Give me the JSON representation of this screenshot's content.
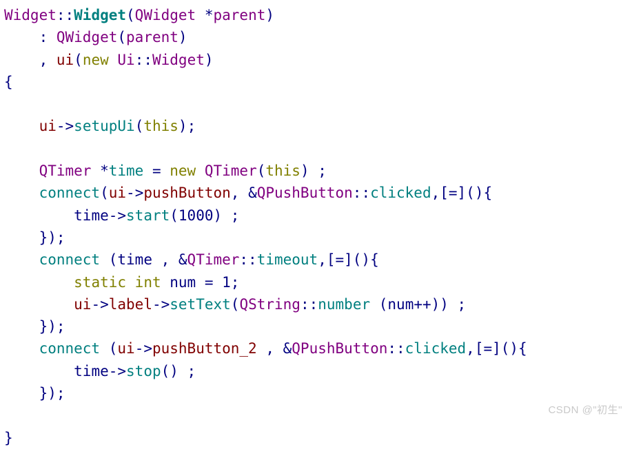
{
  "editor": {
    "background": "#ffffff",
    "language": "cpp",
    "palette": {
      "plain": "#000080",
      "type": "#800080",
      "function": "#007f7f",
      "keyword": "#808000",
      "member": "#800000",
      "number": "#000080",
      "punctuation": "#000080",
      "watermark": "#c9c9c9"
    },
    "lines": [
      {
        "index": 0,
        "text": "Widget::Widget(QWidget *parent)",
        "tokens": [
          {
            "t": "Widget",
            "c": "#800080"
          },
          {
            "t": "::",
            "c": "#000080"
          },
          {
            "t": "Widget",
            "c": "#007f7f",
            "b": true
          },
          {
            "t": "(",
            "c": "#000080"
          },
          {
            "t": "QWidget",
            "c": "#800080"
          },
          {
            "t": " ",
            "c": "#000080"
          },
          {
            "t": "*",
            "c": "#000080"
          },
          {
            "t": "parent",
            "c": "#800080"
          },
          {
            "t": ")",
            "c": "#000080"
          }
        ]
      },
      {
        "index": 1,
        "text": "    : QWidget(parent)",
        "tokens": [
          {
            "t": "    : ",
            "c": "#000080"
          },
          {
            "t": "QWidget",
            "c": "#800080"
          },
          {
            "t": "(",
            "c": "#000080"
          },
          {
            "t": "parent",
            "c": "#800080"
          },
          {
            "t": ")",
            "c": "#000080"
          }
        ]
      },
      {
        "index": 2,
        "text": "    , ui(new Ui::Widget)",
        "tokens": [
          {
            "t": "    , ",
            "c": "#000080"
          },
          {
            "t": "ui",
            "c": "#800000"
          },
          {
            "t": "(",
            "c": "#000080"
          },
          {
            "t": "new",
            "c": "#808000"
          },
          {
            "t": " ",
            "c": "#000080"
          },
          {
            "t": "Ui",
            "c": "#800080"
          },
          {
            "t": "::",
            "c": "#000080"
          },
          {
            "t": "Widget",
            "c": "#800080"
          },
          {
            "t": ")",
            "c": "#000080"
          }
        ]
      },
      {
        "index": 3,
        "text": "{",
        "tokens": [
          {
            "t": "{",
            "c": "#000080"
          }
        ]
      },
      {
        "index": 4,
        "text": "",
        "tokens": []
      },
      {
        "index": 5,
        "text": "    ui->setupUi(this);",
        "tokens": [
          {
            "t": "    ",
            "c": "#000080"
          },
          {
            "t": "ui",
            "c": "#800000"
          },
          {
            "t": "->",
            "c": "#000080"
          },
          {
            "t": "setupUi",
            "c": "#007f7f"
          },
          {
            "t": "(",
            "c": "#000080"
          },
          {
            "t": "this",
            "c": "#808000"
          },
          {
            "t": ");",
            "c": "#000080"
          }
        ]
      },
      {
        "index": 6,
        "text": "",
        "tokens": []
      },
      {
        "index": 7,
        "text": "    QTimer *time = new QTimer(this) ;",
        "tokens": [
          {
            "t": "    ",
            "c": "#000080"
          },
          {
            "t": "QTimer",
            "c": "#800080"
          },
          {
            "t": " ",
            "c": "#000080"
          },
          {
            "t": "*",
            "c": "#000080"
          },
          {
            "t": "time",
            "c": "#007f7f"
          },
          {
            "t": " = ",
            "c": "#000080"
          },
          {
            "t": "new",
            "c": "#808000"
          },
          {
            "t": " ",
            "c": "#000080"
          },
          {
            "t": "QTimer",
            "c": "#800080"
          },
          {
            "t": "(",
            "c": "#000080"
          },
          {
            "t": "this",
            "c": "#808000"
          },
          {
            "t": ") ;",
            "c": "#000080"
          }
        ]
      },
      {
        "index": 8,
        "text": "    connect(ui->pushButton, &QPushButton::clicked,[=](){",
        "tokens": [
          {
            "t": "    ",
            "c": "#000080"
          },
          {
            "t": "connect",
            "c": "#007f7f"
          },
          {
            "t": "(",
            "c": "#000080"
          },
          {
            "t": "ui",
            "c": "#800000"
          },
          {
            "t": "->",
            "c": "#000080"
          },
          {
            "t": "pushButton",
            "c": "#800000"
          },
          {
            "t": ", &",
            "c": "#000080"
          },
          {
            "t": "QPushButton",
            "c": "#800080"
          },
          {
            "t": "::",
            "c": "#000080"
          },
          {
            "t": "clicked",
            "c": "#007f7f"
          },
          {
            "t": ",[=](){",
            "c": "#000080"
          }
        ]
      },
      {
        "index": 9,
        "text": "        time->start(1000) ;",
        "tokens": [
          {
            "t": "        ",
            "c": "#000080"
          },
          {
            "t": "time",
            "c": "#000080"
          },
          {
            "t": "->",
            "c": "#000080"
          },
          {
            "t": "start",
            "c": "#007f7f"
          },
          {
            "t": "(",
            "c": "#000080"
          },
          {
            "t": "1000",
            "c": "#000080"
          },
          {
            "t": ") ;",
            "c": "#000080"
          }
        ]
      },
      {
        "index": 10,
        "text": "    });",
        "tokens": [
          {
            "t": "    });",
            "c": "#000080"
          }
        ]
      },
      {
        "index": 11,
        "text": "    connect (time , &QTimer::timeout,[=](){",
        "tokens": [
          {
            "t": "    ",
            "c": "#000080"
          },
          {
            "t": "connect",
            "c": "#007f7f"
          },
          {
            "t": " (",
            "c": "#000080"
          },
          {
            "t": "time",
            "c": "#000080"
          },
          {
            "t": " , &",
            "c": "#000080"
          },
          {
            "t": "QTimer",
            "c": "#800080"
          },
          {
            "t": "::",
            "c": "#000080"
          },
          {
            "t": "timeout",
            "c": "#007f7f"
          },
          {
            "t": ",[=](){",
            "c": "#000080"
          }
        ]
      },
      {
        "index": 12,
        "text": "        static int num = 1;",
        "tokens": [
          {
            "t": "        ",
            "c": "#000080"
          },
          {
            "t": "static",
            "c": "#808000"
          },
          {
            "t": " ",
            "c": "#000080"
          },
          {
            "t": "int",
            "c": "#808000"
          },
          {
            "t": " ",
            "c": "#000080"
          },
          {
            "t": "num",
            "c": "#000080"
          },
          {
            "t": " = ",
            "c": "#000080"
          },
          {
            "t": "1",
            "c": "#000080"
          },
          {
            "t": ";",
            "c": "#000080"
          }
        ]
      },
      {
        "index": 13,
        "text": "        ui->label->setText(QString::number (num++)) ;",
        "tokens": [
          {
            "t": "        ",
            "c": "#000080"
          },
          {
            "t": "ui",
            "c": "#800000"
          },
          {
            "t": "->",
            "c": "#000080"
          },
          {
            "t": "label",
            "c": "#800000"
          },
          {
            "t": "->",
            "c": "#000080"
          },
          {
            "t": "setText",
            "c": "#007f7f"
          },
          {
            "t": "(",
            "c": "#000080"
          },
          {
            "t": "QString",
            "c": "#800080"
          },
          {
            "t": "::",
            "c": "#000080"
          },
          {
            "t": "number",
            "c": "#007f7f"
          },
          {
            "t": " (",
            "c": "#000080"
          },
          {
            "t": "num",
            "c": "#000080"
          },
          {
            "t": "++)) ;",
            "c": "#000080"
          }
        ]
      },
      {
        "index": 14,
        "text": "    });",
        "tokens": [
          {
            "t": "    });",
            "c": "#000080"
          }
        ]
      },
      {
        "index": 15,
        "text": "    connect (ui->pushButton_2 , &QPushButton::clicked,[=](){",
        "tokens": [
          {
            "t": "    ",
            "c": "#000080"
          },
          {
            "t": "connect",
            "c": "#007f7f"
          },
          {
            "t": " (",
            "c": "#000080"
          },
          {
            "t": "ui",
            "c": "#800000"
          },
          {
            "t": "->",
            "c": "#000080"
          },
          {
            "t": "pushButton_2",
            "c": "#800000"
          },
          {
            "t": " , &",
            "c": "#000080"
          },
          {
            "t": "QPushButton",
            "c": "#800080"
          },
          {
            "t": "::",
            "c": "#000080"
          },
          {
            "t": "clicked",
            "c": "#007f7f"
          },
          {
            "t": ",[=](){",
            "c": "#000080"
          }
        ]
      },
      {
        "index": 16,
        "text": "        time->stop() ;",
        "tokens": [
          {
            "t": "        ",
            "c": "#000080"
          },
          {
            "t": "time",
            "c": "#000080"
          },
          {
            "t": "->",
            "c": "#000080"
          },
          {
            "t": "stop",
            "c": "#007f7f"
          },
          {
            "t": "() ;",
            "c": "#000080"
          }
        ]
      },
      {
        "index": 17,
        "text": "    });",
        "tokens": [
          {
            "t": "    });",
            "c": "#000080"
          }
        ]
      },
      {
        "index": 18,
        "text": "",
        "tokens": []
      },
      {
        "index": 19,
        "text": "}",
        "tokens": [
          {
            "t": "}",
            "c": "#000080"
          }
        ]
      }
    ]
  },
  "watermark": {
    "text": "CSDN @\"初生\""
  }
}
